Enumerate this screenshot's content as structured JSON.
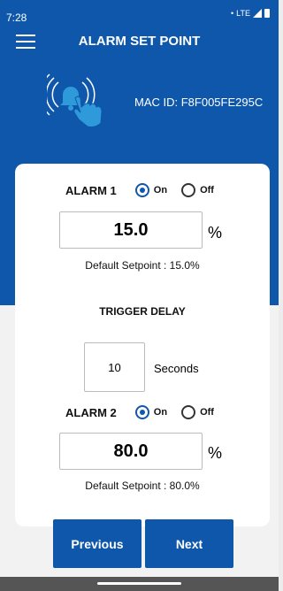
{
  "status_bar": {
    "time": "7:28",
    "network": "LTE"
  },
  "header": {
    "title": "ALARM SET POINT"
  },
  "device": {
    "mac_text": "MAC ID: F8F005FE295C"
  },
  "alarm1": {
    "label": "ALARM 1",
    "on_label": "On",
    "off_label": "Off",
    "selected": "On",
    "value": "15.0",
    "unit": "%",
    "default_text": "Default Setpoint : 15.0%"
  },
  "trigger_delay": {
    "label": "TRIGGER DELAY",
    "value": "10",
    "unit": "Seconds"
  },
  "alarm2": {
    "label": "ALARM 2",
    "on_label": "On",
    "off_label": "Off",
    "selected": "On",
    "value": "80.0",
    "unit": "%",
    "default_text": "Default Setpoint : 80.0%"
  },
  "buttons": {
    "previous": "Previous",
    "next": "Next"
  },
  "icons": {
    "menu": "hamburger-menu-icon",
    "alarm": "alarm-touch-icon"
  },
  "colors": {
    "primary": "#0f57aa"
  }
}
